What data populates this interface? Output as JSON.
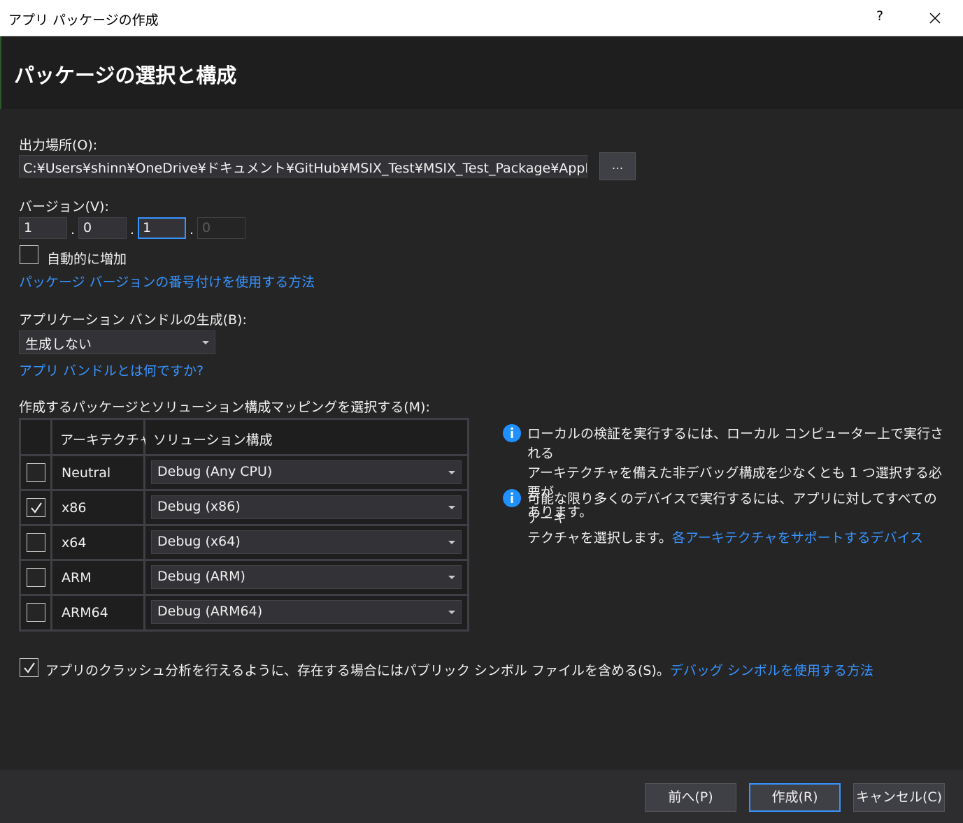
{
  "window": {
    "title": "アプリ パッケージの作成",
    "help_label": "?"
  },
  "header": {
    "heading": "パッケージの選択と構成"
  },
  "output": {
    "label": "出力場所(O):",
    "path": "C:¥Users¥shinn¥OneDrive¥ドキュメント¥GitHub¥MSIX_Test¥MSIX_Test_Package¥AppPackages¥",
    "browse_label": "..."
  },
  "version": {
    "label": "バージョン(V):",
    "major": "1",
    "minor": "0",
    "build": "1",
    "revision": "0",
    "separator": ".",
    "auto_increment_label": "自動的に増加",
    "auto_increment_checked": false,
    "help_link": "パッケージ バージョンの番号付けを使用する方法"
  },
  "bundle": {
    "label": "アプリケーション バンドルの生成(B):",
    "selected": "生成しない",
    "help_link": "アプリ バンドルとは何ですか?"
  },
  "mapping": {
    "label": "作成するパッケージとソリューション構成マッピングを選択する(M):",
    "headers": {
      "architecture": "アーキテクチャ",
      "configuration": "ソリューション構成"
    },
    "rows": [
      {
        "architecture": "Neutral",
        "configuration": "Debug (Any CPU)",
        "checked": false
      },
      {
        "architecture": "x86",
        "configuration": "Debug (x86)",
        "checked": true
      },
      {
        "architecture": "x64",
        "configuration": "Debug (x64)",
        "checked": false
      },
      {
        "architecture": "ARM",
        "configuration": "Debug (ARM)",
        "checked": false
      },
      {
        "architecture": "ARM64",
        "configuration": "Debug (ARM64)",
        "checked": false
      }
    ]
  },
  "info": [
    {
      "icon": "info-icon",
      "line1": "ローカルの検証を実行するには、ローカル コンピューター上で実行される",
      "line2": "アーキテクチャを備えた非デバッグ構成を少なくとも 1 つ選択する必要が",
      "line3": "あります。"
    },
    {
      "icon": "info-icon",
      "line1": "可能な限り多くのデバイスで実行するには、アプリに対してすべてのアーキ",
      "line2": "テクチャを選択します。",
      "link": "各アーキテクチャをサポートするデバイス"
    }
  ],
  "symbols": {
    "checked": true,
    "label": "アプリのクラッシュ分析を行えるように、存在する場合にはパブリック シンボル ファイルを含める(S)。",
    "help_link": "デバッグ シンボルを使用する方法"
  },
  "buttons": {
    "back": "前へ(P)",
    "create": "作成(R)",
    "cancel": "キャンセル(C)"
  },
  "colors": {
    "accent": "#3794ff",
    "background": "#252526",
    "header_background": "#1e1e1e",
    "titlebar_background": "#ffffff"
  }
}
